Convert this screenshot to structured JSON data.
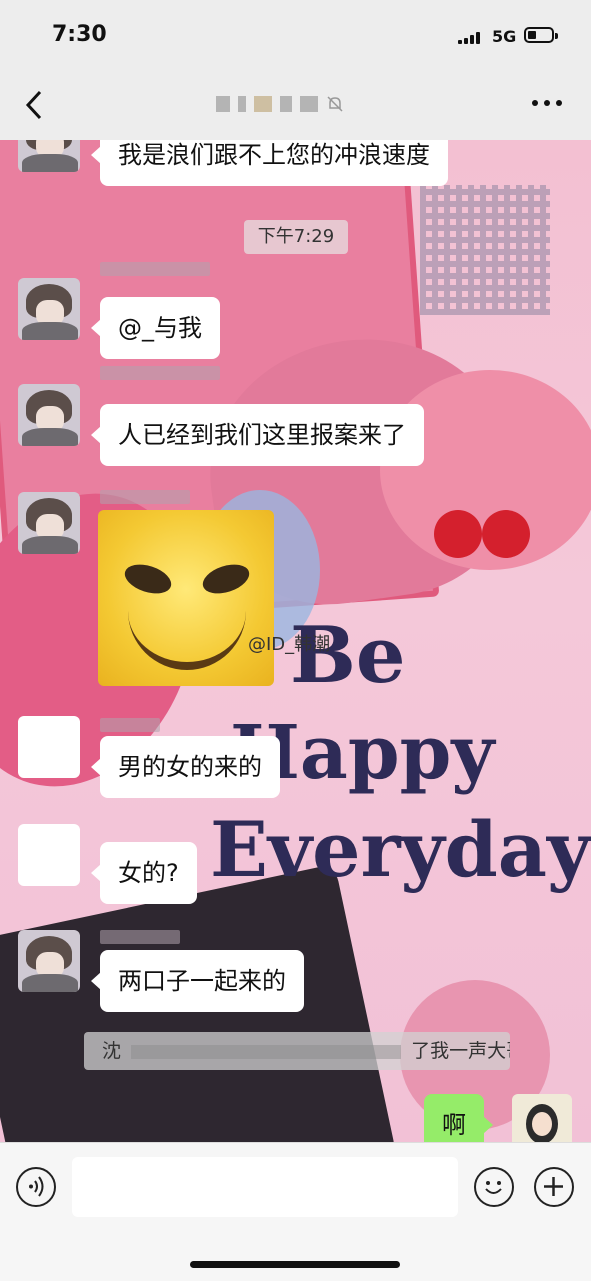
{
  "status_bar": {
    "time": "7:30",
    "network": "5G"
  },
  "nav": {
    "title": "",
    "back_icon": "chevron-left-icon",
    "more_icon": "more-dots-icon"
  },
  "decor": {
    "be": "Be",
    "happy": "Happy",
    "everyday": "Everyday"
  },
  "timestamp": "下午7:29",
  "messages": [
    {
      "type": "text",
      "side": "left",
      "text": "我是浪们跟不上您的冲浪速度"
    },
    {
      "type": "text",
      "side": "left",
      "text": "@_与我"
    },
    {
      "type": "text",
      "side": "left",
      "text": "人已经到我们这里报案来了"
    },
    {
      "type": "sticker",
      "side": "left",
      "watermark": "@ID_韩潮"
    },
    {
      "type": "text",
      "side": "left",
      "text": "男的女的来的"
    },
    {
      "type": "text",
      "side": "left",
      "text": "女的?"
    },
    {
      "type": "text",
      "side": "left",
      "text": "两口子一起来的"
    },
    {
      "type": "system",
      "text": "沈"
    },
    {
      "type": "system_tail",
      "text": "了我一声大哥"
    },
    {
      "type": "text",
      "side": "right",
      "text": "啊"
    }
  ],
  "input_bar": {
    "voice_icon": "voice-icon",
    "emoji_icon": "emoji-icon",
    "plus_icon": "plus-icon"
  },
  "colors": {
    "bubble_self": "#95ec69",
    "bubble_other": "#ffffff",
    "bar_bg": "#ededed"
  }
}
